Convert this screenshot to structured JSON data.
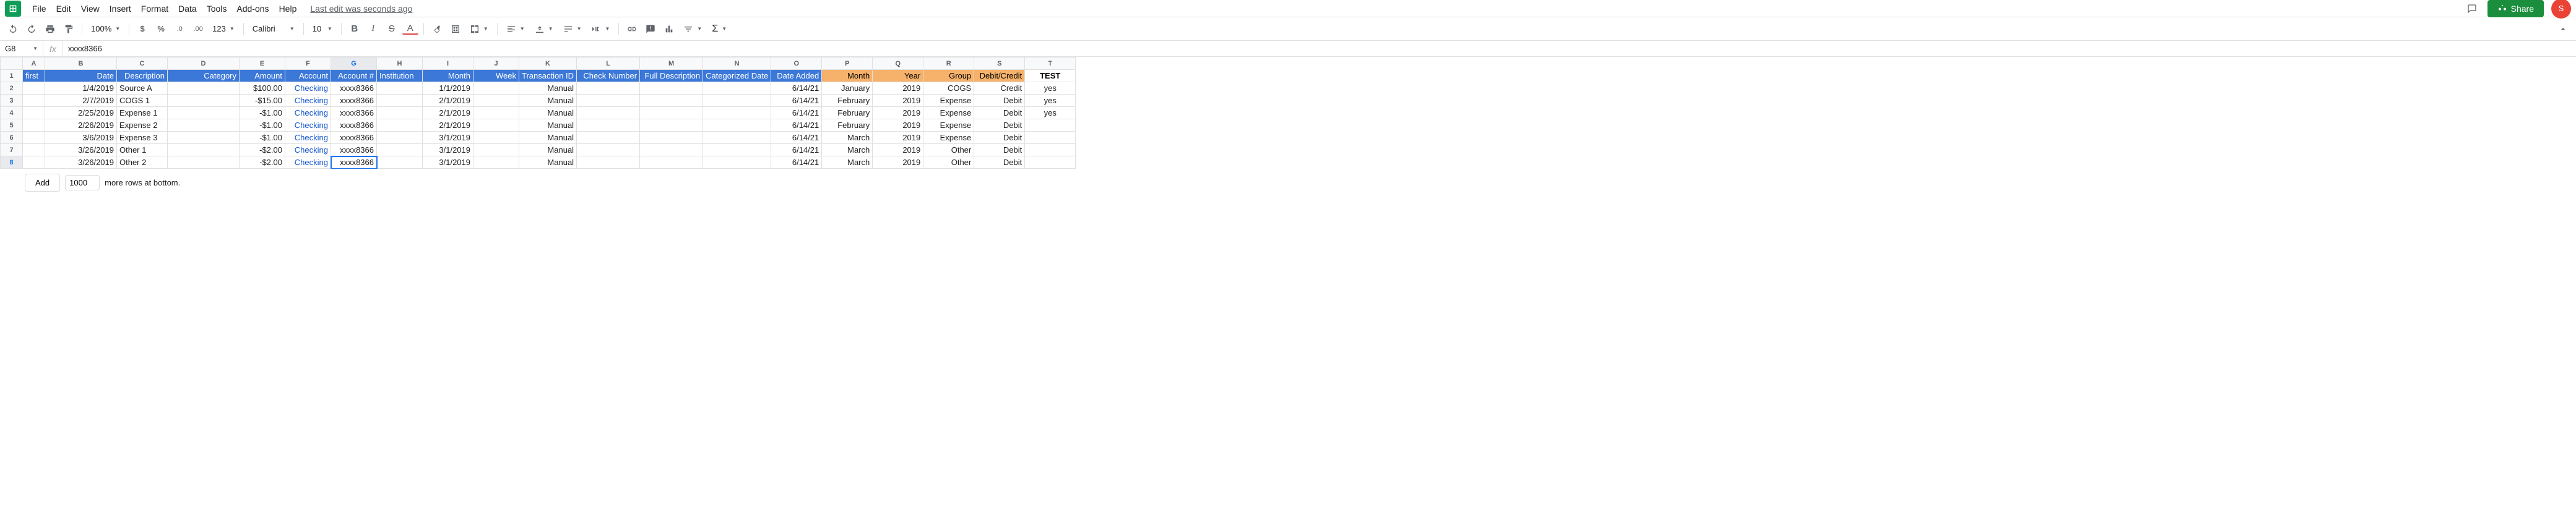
{
  "menu": {
    "items": [
      "File",
      "Edit",
      "View",
      "Insert",
      "Format",
      "Data",
      "Tools",
      "Add-ons",
      "Help"
    ],
    "last_edit": "Last edit was seconds ago",
    "share": "Share",
    "avatar": "S"
  },
  "toolbar": {
    "zoom": "100%",
    "font": "Calibri",
    "font_size": "10",
    "decimal_dec": ".0",
    "decimal_inc": ".00",
    "format_123": "123"
  },
  "formula_bar": {
    "name_box": "G8",
    "fx": "fx",
    "value": "xxxx8366"
  },
  "columns": [
    {
      "letter": "A",
      "width": 36
    },
    {
      "letter": "B",
      "width": 116
    },
    {
      "letter": "C",
      "width": 82
    },
    {
      "letter": "D",
      "width": 116
    },
    {
      "letter": "E",
      "width": 74
    },
    {
      "letter": "F",
      "width": 74
    },
    {
      "letter": "G",
      "width": 74
    },
    {
      "letter": "H",
      "width": 74
    },
    {
      "letter": "I",
      "width": 82
    },
    {
      "letter": "J",
      "width": 74
    },
    {
      "letter": "K",
      "width": 82
    },
    {
      "letter": "L",
      "width": 102
    },
    {
      "letter": "M",
      "width": 102
    },
    {
      "letter": "N",
      "width": 102
    },
    {
      "letter": "O",
      "width": 82
    },
    {
      "letter": "P",
      "width": 82
    },
    {
      "letter": "Q",
      "width": 82
    },
    {
      "letter": "R",
      "width": 82
    },
    {
      "letter": "S",
      "width": 82
    },
    {
      "letter": "T",
      "width": 82
    }
  ],
  "header_row": {
    "blue": [
      "first",
      "Date",
      "Description",
      "Category",
      "Amount",
      "Account",
      "Account #",
      "Institution",
      "Month",
      "Week",
      "Transaction ID",
      "Check Number",
      "Full Description",
      "Categorized Date",
      "Date Added"
    ],
    "orange": [
      "Month",
      "Year",
      "Group",
      "Debit/Credit"
    ],
    "white": "TEST"
  },
  "rows": [
    {
      "n": 2,
      "Date": "1/4/2019",
      "Description": "Source A",
      "Amount": "$100.00",
      "Account": "Checking",
      "AccountNum": "xxxx8366",
      "Month": "1/1/2019",
      "TransactionID": "Manual",
      "DateAdded": "6/14/21",
      "Month2": "January",
      "Year": "2019",
      "Group": "COGS",
      "DC": "Credit",
      "TEST": "yes"
    },
    {
      "n": 3,
      "Date": "2/7/2019",
      "Description": "COGS 1",
      "Amount": "-$15.00",
      "Account": "Checking",
      "AccountNum": "xxxx8366",
      "Month": "2/1/2019",
      "TransactionID": "Manual",
      "DateAdded": "6/14/21",
      "Month2": "February",
      "Year": "2019",
      "Group": "Expense",
      "DC": "Debit",
      "TEST": "yes"
    },
    {
      "n": 4,
      "Date": "2/25/2019",
      "Description": "Expense 1",
      "Amount": "-$1.00",
      "Account": "Checking",
      "AccountNum": "xxxx8366",
      "Month": "2/1/2019",
      "TransactionID": "Manual",
      "DateAdded": "6/14/21",
      "Month2": "February",
      "Year": "2019",
      "Group": "Expense",
      "DC": "Debit",
      "TEST": "yes"
    },
    {
      "n": 5,
      "Date": "2/26/2019",
      "Description": "Expense 2",
      "Amount": "-$1.00",
      "Account": "Checking",
      "AccountNum": "xxxx8366",
      "Month": "2/1/2019",
      "TransactionID": "Manual",
      "DateAdded": "6/14/21",
      "Month2": "February",
      "Year": "2019",
      "Group": "Expense",
      "DC": "Debit",
      "TEST": ""
    },
    {
      "n": 6,
      "Date": "3/6/2019",
      "Description": "Expense 3",
      "Amount": "-$1.00",
      "Account": "Checking",
      "AccountNum": "xxxx8366",
      "Month": "3/1/2019",
      "TransactionID": "Manual",
      "DateAdded": "6/14/21",
      "Month2": "March",
      "Year": "2019",
      "Group": "Expense",
      "DC": "Debit",
      "TEST": ""
    },
    {
      "n": 7,
      "Date": "3/26/2019",
      "Description": "Other 1",
      "Amount": "-$2.00",
      "Account": "Checking",
      "AccountNum": "xxxx8366",
      "Month": "3/1/2019",
      "TransactionID": "Manual",
      "DateAdded": "6/14/21",
      "Month2": "March",
      "Year": "2019",
      "Group": "Other",
      "DC": "Debit",
      "TEST": ""
    },
    {
      "n": 8,
      "Date": "3/26/2019",
      "Description": "Other 2",
      "Amount": "-$2.00",
      "Account": "Checking",
      "AccountNum": "xxxx8366",
      "Month": "3/1/2019",
      "TransactionID": "Manual",
      "DateAdded": "6/14/21",
      "Month2": "March",
      "Year": "2019",
      "Group": "Other",
      "DC": "Debit",
      "TEST": ""
    }
  ],
  "add_rows": {
    "button": "Add",
    "count": "1000",
    "suffix": "more rows at bottom."
  }
}
